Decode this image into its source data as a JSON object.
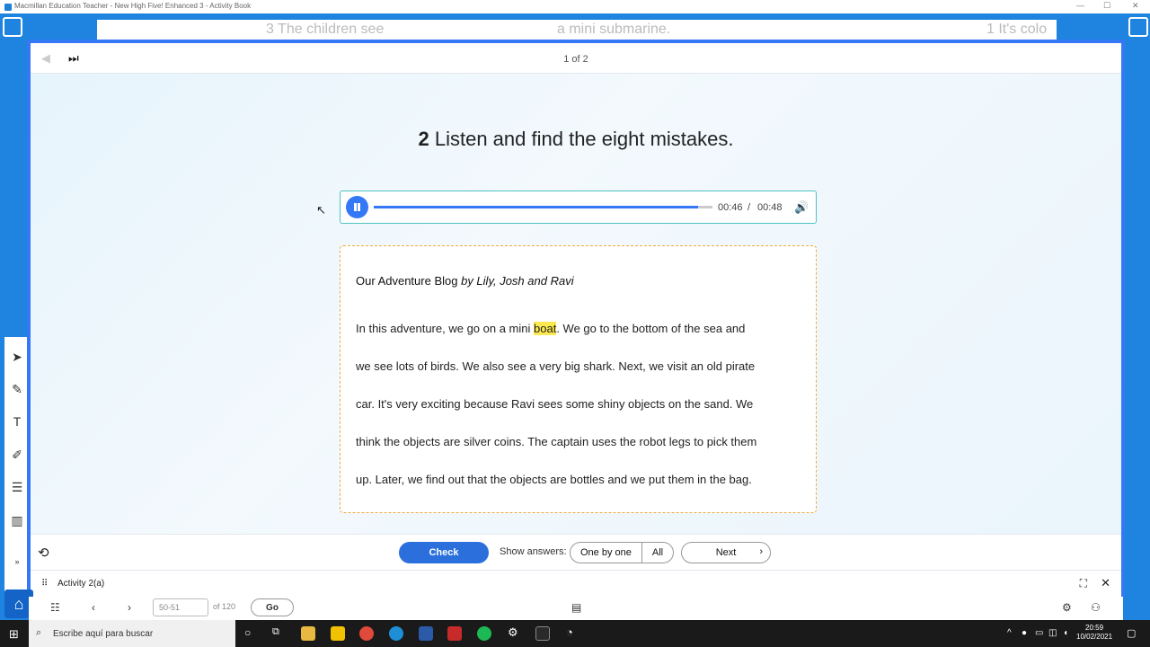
{
  "window": {
    "title": "Macmillan Education Teacher - New High Five! Enhanced 3 - Activity Book",
    "min": "—",
    "max": "☐",
    "close": "✕"
  },
  "book_strip": {
    "text_left": "3  The children see",
    "text_mid": "a mini submarine.",
    "text_right": "1  It's colo"
  },
  "modal": {
    "page_indicator": "1 of 2",
    "skip_icon": "⏭",
    "activity_number": "2",
    "activity_instruction": "Listen and find the eight mistakes.",
    "audio": {
      "current_time": "00:46",
      "separator": "/",
      "total_time": "00:48",
      "progress": 0.958,
      "volume_icon": "🔊"
    },
    "blog": {
      "title": "Our Adventure Blog",
      "authors": "by Lily, Josh and Ravi",
      "line1_before": "In this adventure, we go on a mini ",
      "line1_highlight": "boat",
      "line1_after": ". We go to the bottom of the sea and",
      "line2": "we see lots of birds. We also see a very big shark. Next, we visit an old pirate",
      "line3": "car. It's very exciting because Ravi sees some shiny objects on the sand. We",
      "line4": "think the objects are silver coins. The captain uses the robot legs to pick them",
      "line5": "up. Later, we find out that the objects are bottles and we put them in the bag."
    },
    "footer": {
      "reset_icon": "⟲",
      "check_label": "Check",
      "show_answers_label": "Show answers:",
      "one_by_one_label": "One by one",
      "all_label": "All",
      "next_label": "Next",
      "next_chevron": "›"
    },
    "status": {
      "grip_icon": "⠿",
      "activity_label": "Activity 2(a)",
      "fullscreen_icon": "⛶",
      "close_icon": "✕"
    }
  },
  "book_nav": {
    "page_value": "50-51",
    "of_pages": "of 120",
    "go_label": "Go",
    "prev": "‹",
    "next": "›"
  },
  "taskbar": {
    "search_placeholder": "Escribe aquí para buscar",
    "time": "20:59",
    "date": "10/02/2021"
  },
  "colors": {
    "accent": "#3478f6",
    "highlight": "#fce94f",
    "audio_border": "#4dc2c0",
    "blog_border": "#f2a93b"
  }
}
